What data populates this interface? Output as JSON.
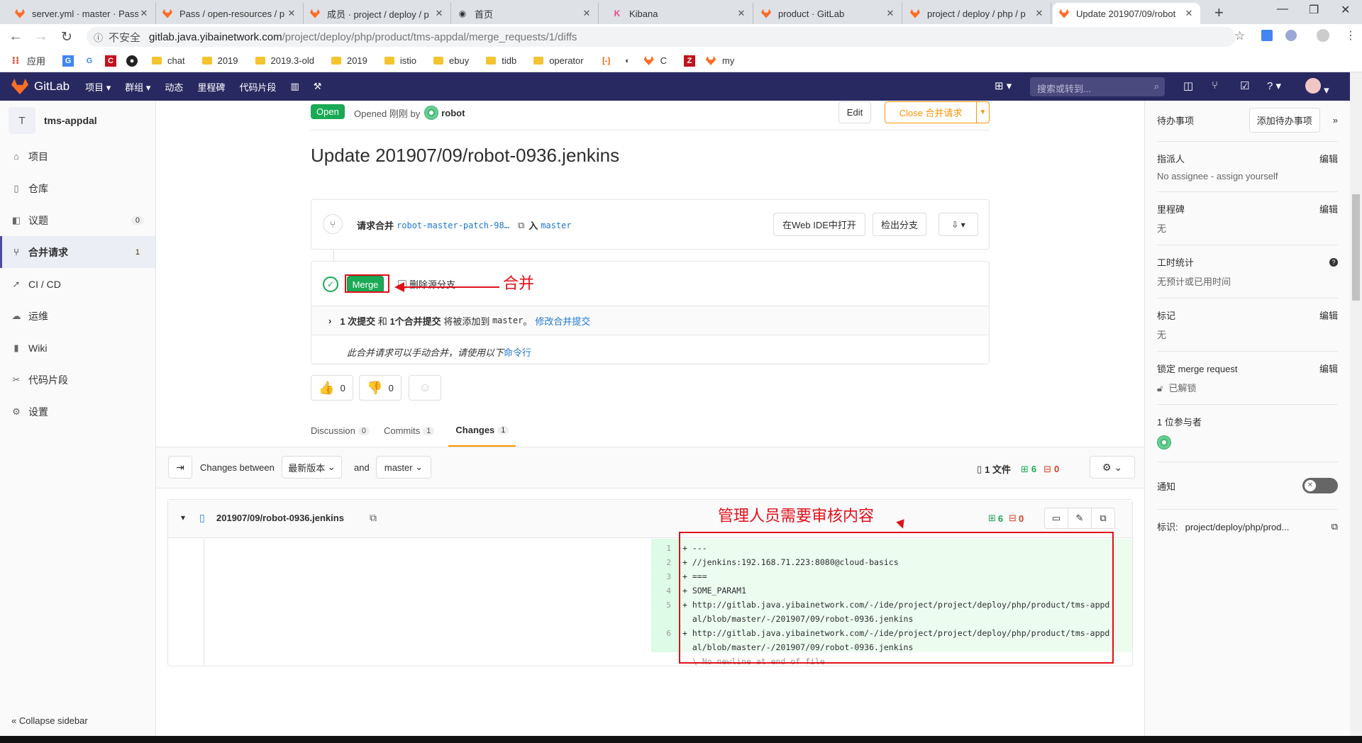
{
  "browser": {
    "tabs": [
      {
        "title": "server.yml · master · Pass",
        "icon": "gitlab-icon"
      },
      {
        "title": "Pass / open-resources / p",
        "icon": "gitlab-icon"
      },
      {
        "title": "成员 · project / deploy / p",
        "icon": "gitlab-icon"
      },
      {
        "title": "首页",
        "icon": "page-icon"
      },
      {
        "title": "Kibana",
        "icon": "kibana-icon"
      },
      {
        "title": "product · GitLab",
        "icon": "gitlab-icon"
      },
      {
        "title": "project / deploy / php / p",
        "icon": "gitlab-icon"
      },
      {
        "title": "Update 201907/09/robot",
        "icon": "gitlab-icon"
      }
    ],
    "insecure_label": "不安全",
    "url_host": "gitlab.java.yibainetwork.com",
    "url_path": "/project/deploy/php/product/tms-appdal/merge_requests/1/diffs",
    "bookmarks": [
      "应用",
      "chat",
      "2019",
      "2019.3-old",
      "2019",
      "istio",
      "ebuy",
      "tidb",
      "operator",
      "C",
      "my"
    ]
  },
  "header": {
    "brand": "GitLab",
    "nav": [
      "项目",
      "群组",
      "动态",
      "里程碑",
      "代码片段"
    ],
    "search_placeholder": "搜索或转到..."
  },
  "sidebar": {
    "project_initial": "T",
    "project_name": "tms-appdal",
    "items": [
      {
        "label": "项目",
        "icon": "home-icon"
      },
      {
        "label": "仓库",
        "icon": "book-icon"
      },
      {
        "label": "议题",
        "icon": "issues-icon",
        "count": "0"
      },
      {
        "label": "合并请求",
        "icon": "merge-request-icon",
        "count": "1"
      },
      {
        "label": "CI / CD",
        "icon": "rocket-icon"
      },
      {
        "label": "运维",
        "icon": "cloud-icon"
      },
      {
        "label": "Wiki",
        "icon": "wiki-icon"
      },
      {
        "label": "代码片段",
        "icon": "snippet-icon"
      },
      {
        "label": "设置",
        "icon": "gear-icon"
      }
    ],
    "collapse_label": "Collapse sidebar"
  },
  "mr": {
    "status": "Open",
    "opened_text": "Opened 刚刚 by",
    "author": "robot",
    "edit_label": "Edit",
    "close_label": "Close 合并请求",
    "title": "Update 201907/09/robot-0936.jenkins",
    "request_label": "请求合并",
    "source_branch": "robot-master-patch-98…",
    "into_label": "入",
    "target_branch": "master",
    "web_ide_label": "在Web IDE中打开",
    "checkout_label": "检出分支",
    "merge_label": "Merge",
    "delete_source_label": "删除源分支",
    "commits_info_a": "1 次提交",
    "commits_info_and": "和",
    "commits_info_b": "1个合并提交",
    "commits_info_c": "将被添加到",
    "commits_info_branch": "master",
    "commits_info_d": "。",
    "modify_commit_link": "修改合并提交",
    "manual_merge_text": "此合并请求可以手动合并，请使用以下",
    "command_line_link": "命令行",
    "thumbs_up": "0",
    "thumbs_down": "0"
  },
  "tabs": [
    {
      "label": "Discussion",
      "count": "0"
    },
    {
      "label": "Commits",
      "count": "1"
    },
    {
      "label": "Changes",
      "count": "1"
    }
  ],
  "diff_toolbar": {
    "changes_between": "Changes between",
    "version_select": "最新版本",
    "and_label": "and",
    "branch_select": "master",
    "files_count": "1 文件",
    "additions": "6",
    "deletions": "0"
  },
  "file": {
    "path": "201907/09/robot-0936.jenkins",
    "additions": "6",
    "deletions": "0",
    "lines": [
      {
        "n": "1",
        "text": "+ ---"
      },
      {
        "n": "2",
        "text": "+ //jenkins:192.168.71.223:8080@cloud-basics"
      },
      {
        "n": "3",
        "text": "+ ==="
      },
      {
        "n": "4",
        "text": "+ SOME_PARAM1"
      },
      {
        "n": "5",
        "text": "+ http://gitlab.java.yibainetwork.com/-/ide/project/project/deploy/php/product/tms-appd"
      },
      {
        "n": "",
        "text": "  al/blob/master/-/201907/09/robot-0936.jenkins"
      },
      {
        "n": "6",
        "text": "+ http://gitlab.java.yibainetwork.com/-/ide/project/project/deploy/php/product/tms-appd"
      },
      {
        "n": "",
        "text": "  al/blob/master/-/201907/09/robot-0936.jenkins"
      },
      {
        "n": "",
        "text": "  \\ No newline at end of file"
      }
    ]
  },
  "right_sidebar": {
    "todo_label": "待办事项",
    "add_todo": "添加待办事项",
    "assignee_title": "指派人",
    "assignee_value": "No assignee - assign yourself",
    "milestone_title": "里程碑",
    "milestone_value": "无",
    "time_title": "工时统计",
    "time_value": "无预计或已用时间",
    "labels_title": "标记",
    "labels_value": "无",
    "lock_title": "锁定 merge request",
    "lock_value": "已解锁",
    "participants": "1 位参与者",
    "notify_label": "通知",
    "reference_label": "标识:",
    "reference_value": "project/deploy/php/prod...",
    "edit_label": "编辑"
  },
  "annotations": {
    "merge_note": "合并",
    "review_note": "管理人员需要审核内容"
  }
}
